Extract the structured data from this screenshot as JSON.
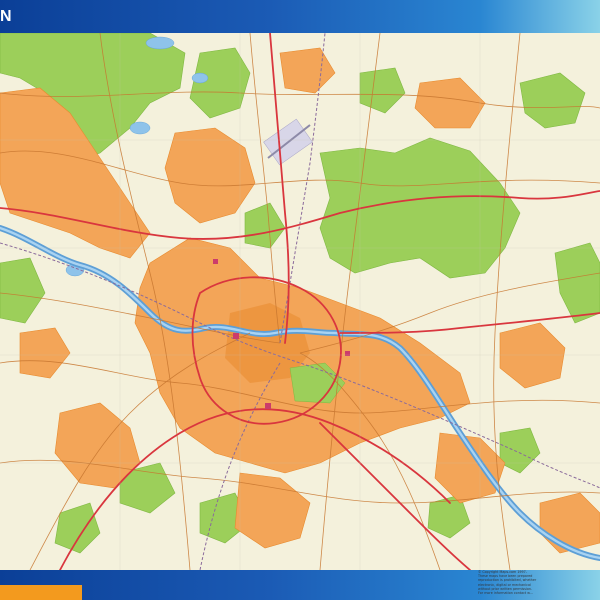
{
  "header": {
    "title": "N"
  },
  "map": {
    "colors": {
      "background": "#f4f1dc",
      "urban": "#f3a558",
      "urban_dark": "#e88a2e",
      "forest": "#9ccf5a",
      "river": "#5d9fd6",
      "water": "#8ec3ea",
      "major_road": "#d9363e",
      "minor_road": "#c7762f",
      "railway": "#8a6a9b",
      "landmark": "#cc3c6b"
    },
    "icons": [
      "river-icon",
      "forest-icon",
      "road-icon",
      "railway-icon"
    ]
  },
  "footer": {
    "accent_color": "#f39a1e",
    "copyright_lines": [
      "© Copyright Maps.com 1997-",
      "These maps have been prepared",
      "reproduction is prohibited, whether",
      "electronic, digital or mechanical",
      "without prior written permission.",
      "For more information contact w..."
    ]
  }
}
